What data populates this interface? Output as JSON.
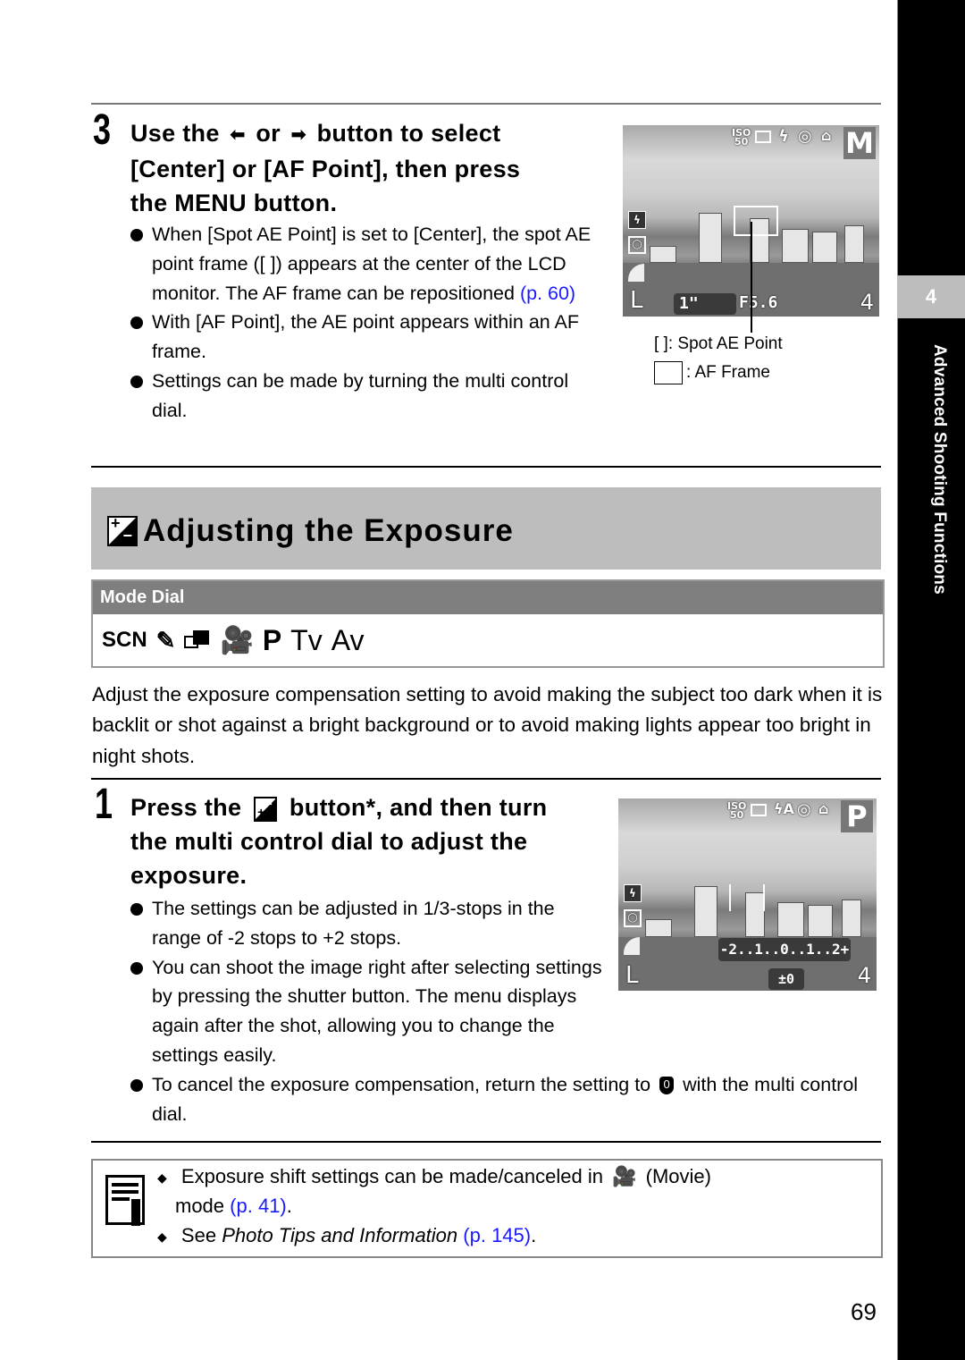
{
  "side_tab": {
    "chapter_number": "4",
    "chapter_title": "Advanced Shooting Functions"
  },
  "step3": {
    "number": "3",
    "title_part1": "Use the",
    "left_arrow": "◆",
    "title_or": "or",
    "right_arrow": "◆",
    "title_part2": "button to select",
    "title_line2": "[Center] or [AF Point], then press",
    "title_line3": "the MENU button.",
    "bullets": [
      {
        "text": "When [Spot AE Point] is set to [Center], the spot AE point frame ([    ]) appears at the center of the LCD monitor. The AF frame can be repositioned",
        "link": "(p. 60)"
      },
      {
        "text": "With [AF Point], the AE point appears within an AF frame."
      },
      {
        "text": "Settings can be made by turning the multi control dial."
      }
    ]
  },
  "lcd1": {
    "mode": "M",
    "top_icons": [
      "ISO 50",
      "frame",
      "flash",
      "eye",
      "camera"
    ],
    "size": "L",
    "shutter": "1\"",
    "aperture": "F5.6",
    "shots_remaining": "4"
  },
  "legend": {
    "spot_ae_label": "[    ]: Spot AE Point",
    "af_frame_label": ": AF Frame"
  },
  "section": {
    "title": "Adjusting the Exposure",
    "mode_dial_label": "Mode Dial",
    "modes": [
      "SCN",
      "stitch-assist",
      "movie",
      "P",
      "Tv",
      "Av"
    ]
  },
  "intro": "Adjust the exposure compensation setting to avoid making the subject too dark when it is backlit or shot against a bright background or to avoid making lights appear too bright in night shots.",
  "step1": {
    "number": "1",
    "title_part1": "Press the",
    "title_part2": "button*, and then turn",
    "title_line2": "the multi control dial to adjust the",
    "title_line3": "exposure.",
    "bullets": [
      {
        "text": "The settings can be adjusted in 1/3-stops in the range of -2 stops to +2 stops."
      },
      {
        "text": "You can shoot the image right after selecting settings by pressing the shutter button. The menu displays again after the shot, allowing you to change the settings easily."
      },
      {
        "text_before": "To cancel the exposure compensation, return the setting to",
        "text_after": "with the multi control dial."
      }
    ]
  },
  "lcd2": {
    "mode": "P",
    "size": "L",
    "scale": "-2..1..0..1..2+",
    "ev_value": "±0",
    "shots_remaining": "4"
  },
  "note": {
    "item1_before": "Exposure shift settings can be made/canceled in",
    "item1_after": "(Movie)",
    "item1_line2": "mode",
    "item1_link": "(p. 41)",
    "item2_before": "See",
    "item2_italic": "Photo Tips and Information",
    "item2_link": "(p. 145)"
  },
  "page_number": "69"
}
